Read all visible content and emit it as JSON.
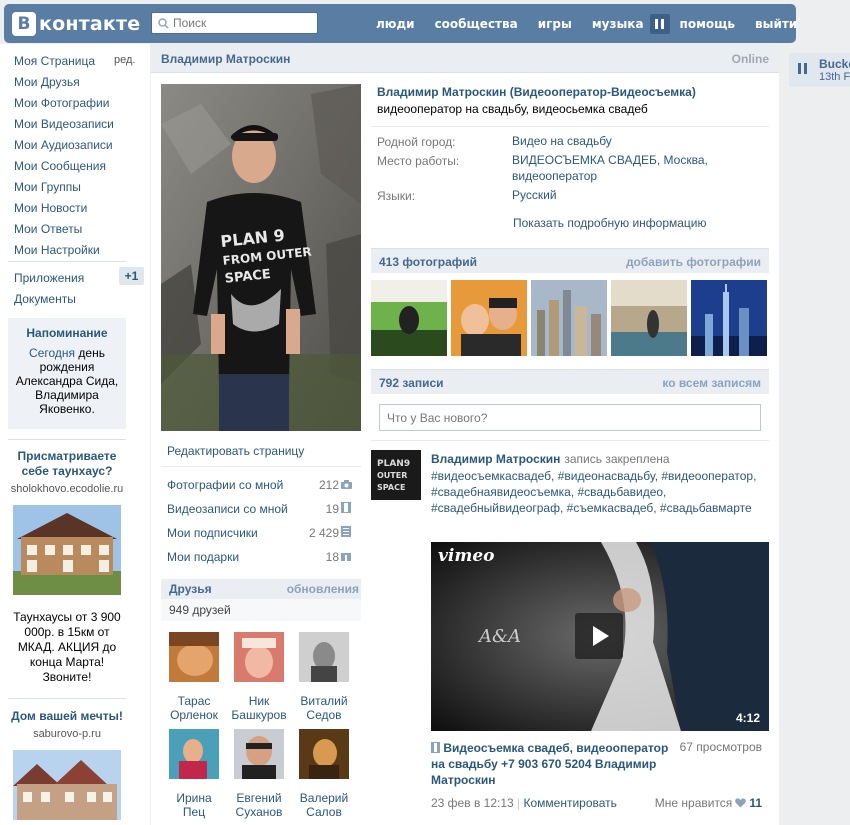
{
  "header": {
    "logo_letter": "В",
    "logo_text": "контакте",
    "search_placeholder": "Поиск",
    "nav": [
      "люди",
      "сообщества",
      "игры",
      "музыка",
      "помощь",
      "выйти"
    ]
  },
  "sidebar": {
    "items": [
      "Моя Страница",
      "Мои Друзья",
      "Мои Фотографии",
      "Мои Видеозаписи",
      "Мои Аудиозаписи",
      "Мои Сообщения",
      "Мои Группы",
      "Мои Новости",
      "Мои Ответы",
      "Мои Настройки"
    ],
    "edit_label": "ред.",
    "apps": "Приложения",
    "apps_badge": "+1",
    "docs": "Документы",
    "reminder": {
      "title": "Напоминание",
      "today": "Сегодня",
      "text": "день рождения Александра Сида, Владимира Яковенко."
    },
    "ad1": {
      "title": "Присматриваете себе таунхаус?",
      "domain": "sholokhovo.ecodolie.ru",
      "desc": "Таунхаусы от 3 900 000р. в 15км от МКАД. АКЦИЯ до конца Марта! Звоните!"
    },
    "ad2": {
      "title": "Дом вашей мечты!",
      "domain": "saburovo-p.ru"
    }
  },
  "profile": {
    "name": "Владимир Матроскин",
    "online": "Online",
    "edit_page": "Редактировать страницу",
    "counters": [
      {
        "label": "Фотографии со мной",
        "count": "212"
      },
      {
        "label": "Видеозаписи со мной",
        "count": "19"
      },
      {
        "label": "Мои подписчики",
        "count": "2 429"
      },
      {
        "label": "Мои подарки",
        "count": "18"
      }
    ],
    "friends": {
      "title": "Друзья",
      "updates": "обновления",
      "count": "949 друзей",
      "list": [
        {
          "first": "Тарас",
          "last": "Орленок"
        },
        {
          "first": "Ник",
          "last": "Башкуров"
        },
        {
          "first": "Виталий",
          "last": "Седов"
        },
        {
          "first": "Ирина",
          "last": "Пец"
        },
        {
          "first": "Евгений",
          "last": "Суханов"
        },
        {
          "first": "Валерий",
          "last": "Салов"
        }
      ]
    }
  },
  "info": {
    "full_name": "Владимир Матроскин (Видеооператор-Видеосъемка)",
    "status": "видеооператор на свадьбу, видеосьемка свадеб",
    "hometown_label": "Родной город:",
    "hometown": "Видео на свадьбу",
    "work_label": "Место работы:",
    "work_line1": "ВИДЕОСЪЕМКА СВАДЕБ, Москва,",
    "work_line2": "видеооператор",
    "lang_label": "Языки:",
    "lang": "Русский",
    "more": "Показать подробную информацию"
  },
  "photos": {
    "title": "413 фотографий",
    "add": "добавить фотографии"
  },
  "wall": {
    "title": "792 записи",
    "all": "ко всем записям",
    "placeholder": "Что у Вас нового?",
    "post": {
      "author": "Владимир Матроскин",
      "pinned": "запись закреплена",
      "tags": "#видеосъемкасвадеб, #видеонасвадьбу, #видеооператор, #свадебнаявидеосъемка, #свадьбавидео, #свадебныйвидеограф, #съемкасвадеб, #свадьбавмарте",
      "video_brand": "vimeo",
      "video_mono": "A&A",
      "duration": "4:12",
      "video_title": "Видеосъемка свадеб, видеооператор на свадьбу +7 903 670 5204 Владимир Матроскин",
      "views": "67 просмотров",
      "date": "23 фев в 12:13",
      "comment": "Комментировать",
      "like_label": "Мне нравится",
      "likes": "11"
    }
  },
  "player": {
    "title": "Bucke",
    "sub": "13th F"
  },
  "colors": {
    "header": "#597da3",
    "link": "#2b587a",
    "bar": "#eaeef2",
    "bg": "#edeef0"
  }
}
